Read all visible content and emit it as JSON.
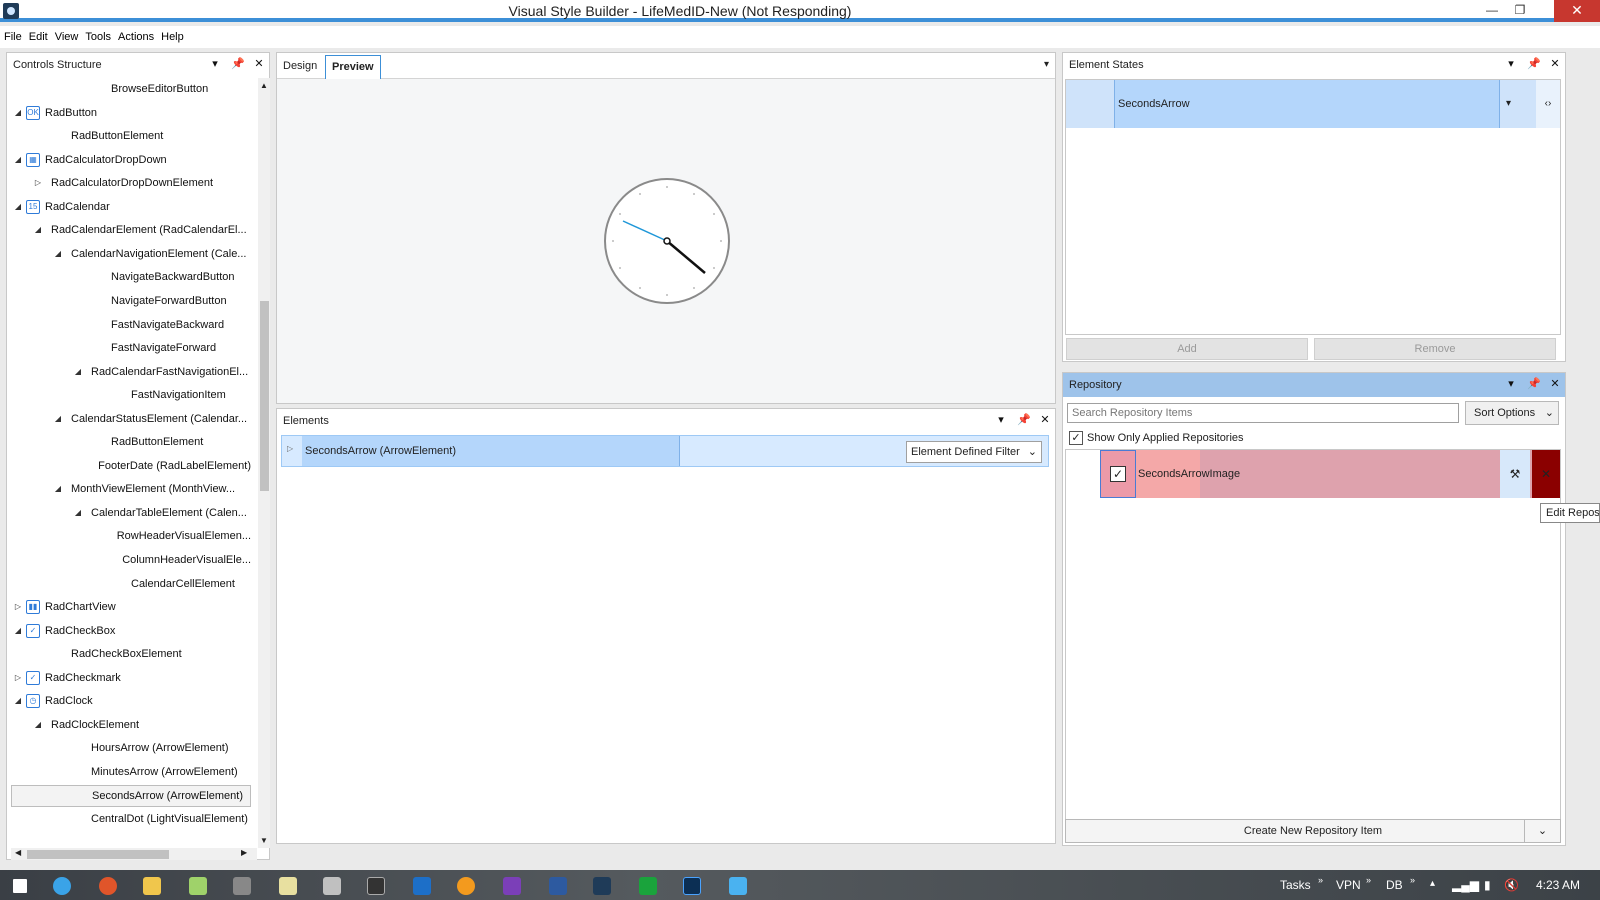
{
  "window": {
    "title": "Visual Style Builder - LifeMedID-New (Not Responding)",
    "minimize": "—",
    "maximize": "❐",
    "close": "✕"
  },
  "menu": [
    "File",
    "Edit",
    "View",
    "Tools",
    "Actions",
    "Help"
  ],
  "controls_structure": {
    "title": "Controls Structure",
    "rows": [
      {
        "label": "BrowseEditorButton",
        "indent": 4,
        "toggle": "",
        "icon": ""
      },
      {
        "label": "RadButton",
        "indent": 0,
        "toggle": "◢",
        "icon": "OK"
      },
      {
        "label": "RadButtonElement",
        "indent": 2,
        "toggle": "",
        "icon": ""
      },
      {
        "label": "RadCalculatorDropDown",
        "indent": 0,
        "toggle": "◢",
        "icon": "▦"
      },
      {
        "label": "RadCalculatorDropDownElement",
        "indent": 1,
        "toggle": "▷",
        "icon": ""
      },
      {
        "label": "RadCalendar",
        "indent": 0,
        "toggle": "◢",
        "icon": "15"
      },
      {
        "label": "RadCalendarElement (RadCalendarEl...",
        "indent": 1,
        "toggle": "◢",
        "icon": ""
      },
      {
        "label": "CalendarNavigationElement (Cale...",
        "indent": 2,
        "toggle": "◢",
        "icon": ""
      },
      {
        "label": "NavigateBackwardButton",
        "indent": 4,
        "toggle": "",
        "icon": ""
      },
      {
        "label": "NavigateForwardButton",
        "indent": 4,
        "toggle": "",
        "icon": ""
      },
      {
        "label": "FastNavigateBackward",
        "indent": 4,
        "toggle": "",
        "icon": ""
      },
      {
        "label": "FastNavigateForward",
        "indent": 4,
        "toggle": "",
        "icon": ""
      },
      {
        "label": "RadCalendarFastNavigationEl...",
        "indent": 3,
        "toggle": "◢",
        "icon": ""
      },
      {
        "label": "FastNavigationItem",
        "indent": 5,
        "toggle": "",
        "icon": ""
      },
      {
        "label": "CalendarStatusElement (Calendar...",
        "indent": 2,
        "toggle": "◢",
        "icon": ""
      },
      {
        "label": "RadButtonElement",
        "indent": 4,
        "toggle": "",
        "icon": ""
      },
      {
        "label": "FooterDate (RadLabelElement)",
        "indent": 4,
        "toggle": "",
        "icon": ""
      },
      {
        "label": "MonthViewElement (MonthView...",
        "indent": 2,
        "toggle": "◢",
        "icon": ""
      },
      {
        "label": "CalendarTableElement (Calen...",
        "indent": 3,
        "toggle": "◢",
        "icon": ""
      },
      {
        "label": "RowHeaderVisualElemen...",
        "indent": 5,
        "toggle": "",
        "icon": ""
      },
      {
        "label": "ColumnHeaderVisualEle...",
        "indent": 5,
        "toggle": "",
        "icon": ""
      },
      {
        "label": "CalendarCellElement",
        "indent": 5,
        "toggle": "",
        "icon": ""
      },
      {
        "label": "RadChartView",
        "indent": 0,
        "toggle": "▷",
        "icon": "▮▮"
      },
      {
        "label": "RadCheckBox",
        "indent": 0,
        "toggle": "◢",
        "icon": "✓"
      },
      {
        "label": "RadCheckBoxElement",
        "indent": 2,
        "toggle": "",
        "icon": ""
      },
      {
        "label": "RadCheckmark",
        "indent": 0,
        "toggle": "▷",
        "icon": "✓"
      },
      {
        "label": "RadClock",
        "indent": 0,
        "toggle": "◢",
        "icon": "◷"
      },
      {
        "label": "RadClockElement",
        "indent": 1,
        "toggle": "◢",
        "icon": ""
      },
      {
        "label": "HoursArrow (ArrowElement)",
        "indent": 3,
        "toggle": "",
        "icon": ""
      },
      {
        "label": "MinutesArrow (ArrowElement)",
        "indent": 3,
        "toggle": "",
        "icon": ""
      },
      {
        "label": "SecondsArrow (ArrowElement)",
        "indent": 3,
        "toggle": "",
        "icon": "",
        "selected": true
      },
      {
        "label": "CentralDot (LightVisualElement)",
        "indent": 3,
        "toggle": "",
        "icon": ""
      }
    ]
  },
  "design": {
    "tabs": [
      "Design",
      "Preview"
    ],
    "active_tab": "Preview"
  },
  "elements": {
    "title": "Elements",
    "selected": "SecondsArrow (ArrowElement)",
    "filter": "Element Defined Filter"
  },
  "element_states": {
    "title": "Element States",
    "selected": "SecondsArrow",
    "add": "Add",
    "remove": "Remove"
  },
  "repository": {
    "title": "Repository",
    "search_placeholder": "Search Repository Items",
    "sort": "Sort Options",
    "show_applied": "Show Only Applied Repositories",
    "item": "SecondsArrowImage",
    "tooltip": "Edit Repos",
    "create": "Create New Repository Item"
  },
  "taskbar": {
    "tasks": "Tasks",
    "vpn": "VPN",
    "db": "DB",
    "time": "4:23 AM"
  },
  "colors": {
    "accent": "#3c8fd7",
    "selection": "#b4d6fb",
    "repo_row": "#dea2ad",
    "delete": "#8b0000"
  }
}
